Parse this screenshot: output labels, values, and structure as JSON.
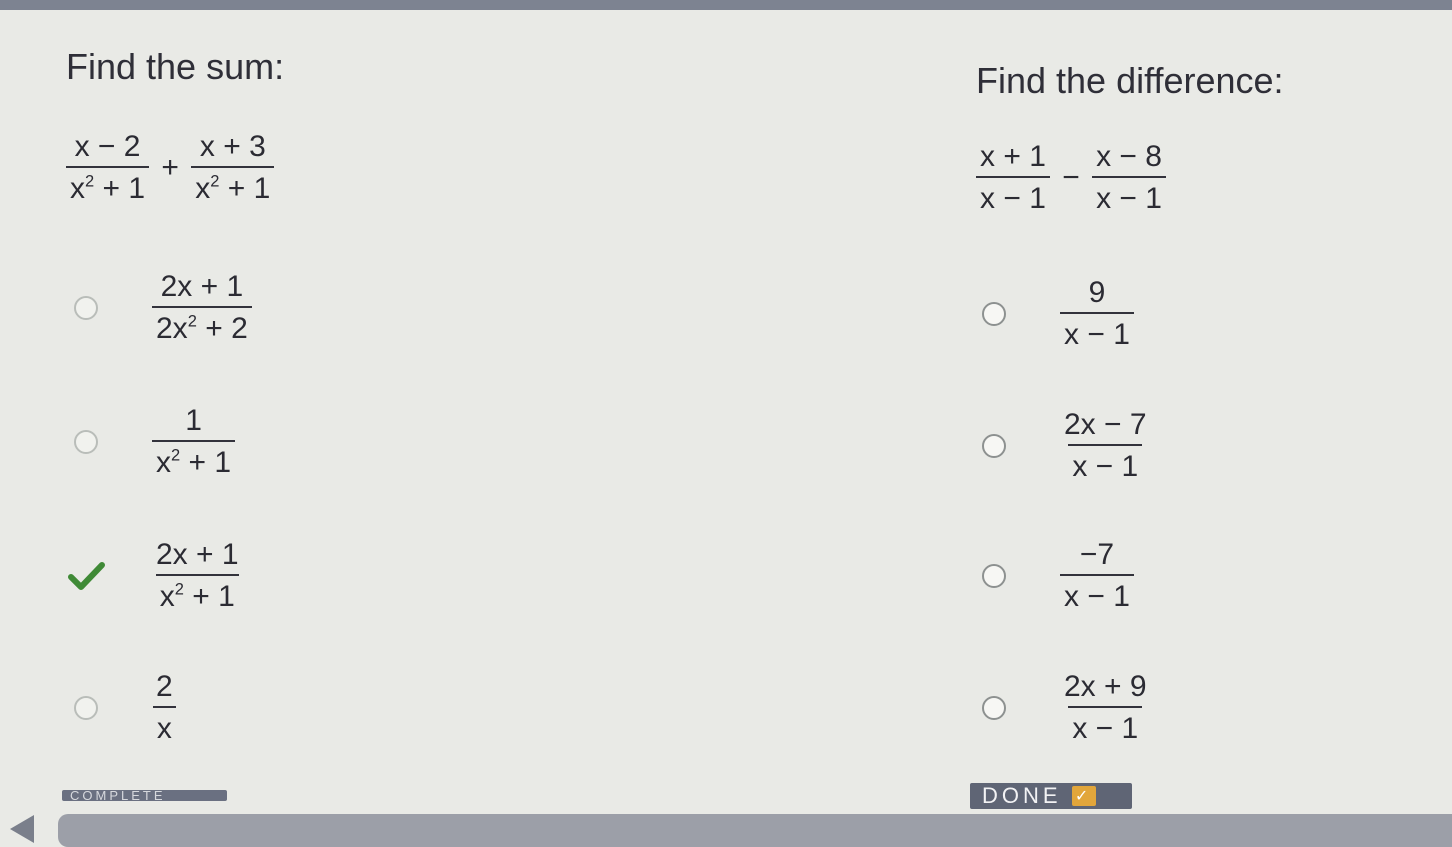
{
  "sum": {
    "title": "Find the sum:",
    "problem": {
      "a_num": "x − 2",
      "a_den_base": "x",
      "a_den_exp": "2",
      "a_den_tail": " + 1",
      "op": "+",
      "b_num": "x + 3",
      "b_den_base": "x",
      "b_den_exp": "2",
      "b_den_tail": " + 1"
    },
    "options": [
      {
        "num": "2x + 1",
        "den_base": "2x",
        "den_exp": "2",
        "den_tail": " + 2",
        "state": "unselected"
      },
      {
        "num": "1",
        "den_base": "x",
        "den_exp": "2",
        "den_tail": " + 1",
        "state": "unselected"
      },
      {
        "num": "2x + 1",
        "den_base": "x",
        "den_exp": "2",
        "den_tail": " + 1",
        "state": "correct"
      },
      {
        "num": "2",
        "den": "x",
        "state": "unselected"
      }
    ]
  },
  "difference": {
    "title": "Find the difference:",
    "problem": {
      "a_num": "x + 1",
      "a_den": "x − 1",
      "op": "−",
      "b_num": "x − 8",
      "b_den": "x − 1"
    },
    "options": [
      {
        "num": "9",
        "den": "x − 1",
        "state": "unselected"
      },
      {
        "num": "2x − 7",
        "den": "x − 1",
        "state": "unselected"
      },
      {
        "num": "−7",
        "den": "x − 1",
        "state": "unselected"
      },
      {
        "num": "2x + 9",
        "den": "x − 1",
        "state": "unselected"
      }
    ]
  },
  "footer": {
    "complete_label": "COMPLETE",
    "done_label": "DONE",
    "done_icon": "check-icon"
  },
  "colors": {
    "accent_check": "#3f8a36",
    "done_badge": "#e2a63b"
  }
}
